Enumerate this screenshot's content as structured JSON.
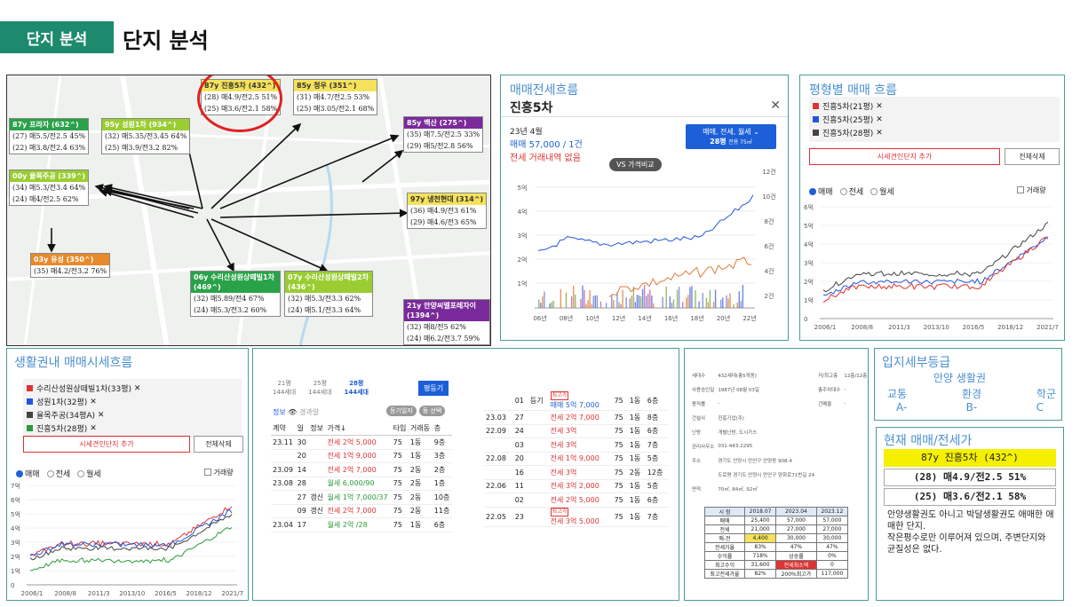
{
  "header": {
    "tag": "단지 분석",
    "title": "단지 분석"
  },
  "map": {
    "labels": [
      {
        "title": "87y 진흥5차 (432^)",
        "color": "#f5e25a",
        "rows": [
          "(28) 매4.9/전2.5 51%",
          "(25) 매3.6/전2.1 58%"
        ]
      },
      {
        "title": "85y 청우 (351^)",
        "color": "#f5e25a",
        "rows": [
          "(31) 매4.7/전2.5 53%",
          "(25) 매3.05/전2.1 68%"
        ]
      },
      {
        "title": "87y 프라자 (632^)",
        "color": "#2aa24a",
        "rows": [
          "(27) 매5.5/전2.5 45%",
          "(22) 매3.8/전2.4 63%"
        ]
      },
      {
        "title": "95y 성원1차 (934^)",
        "color": "#9acd32",
        "rows": [
          "(32) 매5.35/전3.45 64%",
          "(25) 매3.9/전3.2 82%"
        ]
      },
      {
        "title": "85y 백산 (275^)",
        "color": "#7a2a9a",
        "rows": [
          "(35) 매7.5/전2.5 33%",
          "(29) 매5/전2.8 56%"
        ]
      },
      {
        "title": "00y 율목주공 (339^)",
        "color": "#9acd32",
        "rows": [
          "(34) 매5.3/전3.4 64%",
          "(24) 매4/전2.5 62%"
        ]
      },
      {
        "title": "97y 냉천현대 (314^)",
        "color": "#f5e25a",
        "rows": [
          "(36) 매4.9/전3 61%",
          "(29) 매4.6/전3 65%"
        ]
      },
      {
        "title": "03y 유성 (350^)",
        "color": "#e88a2a",
        "rows": [
          "(35) 매4.2/전3.2 76%"
        ]
      },
      {
        "title": "06y 수리산성원상떼빌1차 (469^)",
        "color": "#2aa24a",
        "rows": [
          "(32) 매5.89/전4 67%",
          "(24) 매5.3/전3.2 60%"
        ]
      },
      {
        "title": "07y 수리산성원상떼빌2차 (436^)",
        "color": "#9acd32",
        "rows": [
          "(32) 매5.3/전3.3 62%",
          "(24) 매5.1/전3.3 64%"
        ]
      },
      {
        "title": "21y 안양씨엘포레자이 (1394^)",
        "color": "#7a2a9a",
        "rows": [
          "(32) 매8/전5 62%",
          "(24) 매6.2/전3.7 59%"
        ]
      }
    ]
  },
  "flow": {
    "title": "매매전세흐름",
    "complex": "진흥5차",
    "month": "23년 4월",
    "sale": "매매 57,000 / 1건",
    "rent": "전세 거래내역 없음",
    "filter": "매매, 전세, 월세",
    "size": "28평",
    "size_sub": "전용 75㎡",
    "vs": "VS 가격비교",
    "y_left": [
      "5억",
      "4억",
      "3억",
      "2억",
      "1억"
    ],
    "y_right": [
      "12건",
      "10건",
      "8건",
      "6건",
      "4건",
      "2건"
    ],
    "x": [
      "06년",
      "08년",
      "10년",
      "12년",
      "14년",
      "16년",
      "18년",
      "20년",
      "22년"
    ]
  },
  "pyeong": {
    "title": "평형별 매매 흐름",
    "items": [
      {
        "name": "진흥5차(21평)",
        "color": "#d33"
      },
      {
        "name": "진흥5차(25평)",
        "color": "#2255dd"
      },
      {
        "name": "진흥5차(28평)",
        "color": "#444"
      }
    ],
    "add": "시세견인단지 추가",
    "clear": "전체삭제",
    "radios": [
      "매매",
      "전세",
      "월세"
    ],
    "volume": "거래량",
    "y": [
      "6억",
      "5억",
      "4억",
      "3억",
      "2억",
      "1억",
      "0"
    ],
    "x": [
      "2006/1",
      "2008/8",
      "2011/3",
      "2013/10",
      "2016/5",
      "2018/12",
      "2021/7"
    ]
  },
  "area": {
    "title": "생활권내 매매시세흐름",
    "items": [
      {
        "name": "수리산성원상떼빌1차(33평)",
        "color": "#d33"
      },
      {
        "name": "성원1차(32평)",
        "color": "#2255dd"
      },
      {
        "name": "율목주공(34평A)",
        "color": "#444"
      },
      {
        "name": "진흥5차(28평)",
        "color": "#2a9a3a"
      }
    ],
    "add": "시세견인단지 추가",
    "clear": "전체삭제",
    "radios": [
      "매매",
      "전세",
      "월세"
    ],
    "volume": "거래량",
    "y": [
      "7억",
      "6억",
      "5억",
      "4억",
      "3억",
      "2억",
      "1억",
      "0"
    ],
    "x": [
      "2006/1",
      "2008/8",
      "2011/3",
      "2013/10",
      "2016/5",
      "2018/12",
      "2021/7"
    ]
  },
  "trades": {
    "tabs": [
      {
        "p": "21평",
        "s": "144세대"
      },
      {
        "p": "25평",
        "s": "144세대"
      },
      {
        "p": "28평",
        "s": "144세대"
      }
    ],
    "button": "평등기",
    "info": "정보",
    "auction": "경과알",
    "chip1": "등기일자",
    "chip2": "동 선택",
    "head": [
      "계약",
      "일",
      "정보",
      "가격↓",
      "타입",
      "거래동",
      "층"
    ],
    "rows": [
      {
        "ym": "23.11",
        "d": "30",
        "info": "",
        "price": "전세 2억 5,000",
        "c": "red",
        "t": "75",
        "dong": "1동",
        "fl": "9층"
      },
      {
        "ym": "",
        "d": "20",
        "info": "",
        "price": "전세 1억 9,000",
        "c": "red",
        "t": "75",
        "dong": "1동",
        "fl": "3층"
      },
      {
        "ym": "23.09",
        "d": "14",
        "info": "",
        "price": "전세 2억 7,000",
        "c": "red",
        "t": "75",
        "dong": "2동",
        "fl": "2층"
      },
      {
        "ym": "23.08",
        "d": "28",
        "info": "",
        "price": "월세 6,000/90",
        "c": "green",
        "t": "75",
        "dong": "2동",
        "fl": "1층"
      },
      {
        "ym": "",
        "d": "27",
        "info": "갱신",
        "price": "월세 1억 7,000/37",
        "c": "green",
        "t": "75",
        "dong": "2동",
        "fl": "10층"
      },
      {
        "ym": "",
        "d": "09",
        "info": "갱신",
        "price": "전세 2억 7,000",
        "c": "red",
        "t": "75",
        "dong": "2동",
        "fl": "11층"
      },
      {
        "ym": "23.04",
        "d": "17",
        "info": "",
        "price": "월세 2억 /28",
        "c": "green",
        "t": "75",
        "dong": "1동",
        "fl": "6층"
      }
    ],
    "rows2": [
      {
        "ym": "",
        "d": "01",
        "info": "등기",
        "price": "매매 5억 7,000",
        "c": "blue",
        "t": "75",
        "dong": "1동",
        "fl": "6층",
        "tag": "최고가"
      },
      {
        "ym": "23.03",
        "d": "27",
        "info": "",
        "price": "전세 2억 7,000",
        "c": "red",
        "t": "75",
        "dong": "1동",
        "fl": "8층"
      },
      {
        "ym": "22.09",
        "d": "24",
        "info": "",
        "price": "전세 3억",
        "c": "red",
        "t": "75",
        "dong": "1동",
        "fl": "6층"
      },
      {
        "ym": "",
        "d": "03",
        "info": "",
        "price": "전세 3억",
        "c": "red",
        "t": "75",
        "dong": "1동",
        "fl": "7층"
      },
      {
        "ym": "22.08",
        "d": "20",
        "info": "",
        "price": "전세 1억 9,000",
        "c": "red",
        "t": "75",
        "dong": "1동",
        "fl": "5층"
      },
      {
        "ym": "",
        "d": "16",
        "info": "",
        "price": "전세 3억",
        "c": "red",
        "t": "75",
        "dong": "2동",
        "fl": "12층"
      },
      {
        "ym": "22.06",
        "d": "11",
        "info": "",
        "price": "전세 3억 2,000",
        "c": "red",
        "t": "75",
        "dong": "1동",
        "fl": "5층"
      },
      {
        "ym": "",
        "d": "02",
        "info": "",
        "price": "전세 2억 5,000",
        "c": "red",
        "t": "75",
        "dong": "1동",
        "fl": "6층"
      },
      {
        "ym": "22.05",
        "d": "23",
        "info": "",
        "price": "전세 3억 5,000",
        "c": "red",
        "t": "75",
        "dong": "1동",
        "fl": "7층",
        "tag": "최고가"
      }
    ]
  },
  "detail": {
    "rows": [
      [
        "세대수",
        "432세대(총5개동)",
        "저/최고층",
        "12층/12층"
      ],
      [
        "사용승인일",
        "1987년 08월 03일",
        "총주차대수",
        "-"
      ],
      [
        "용적률",
        "-",
        "건폐율",
        "-"
      ],
      [
        "건설사",
        "진흥기업(주)",
        "",
        ""
      ],
      [
        "난방",
        "개별난방, 도시가스",
        "",
        ""
      ],
      [
        "관리사무소",
        "031-443-2295",
        "",
        ""
      ],
      [
        "주소",
        "경기도 안양시 만안구 안양동 908-4",
        "",
        ""
      ],
      [
        "",
        "도로명 경기도 안양시 만안구 양화로71번길 24",
        "",
        ""
      ],
      [
        "면적",
        "70㎡, 84㎡, 92㎡",
        "",
        ""
      ]
    ],
    "yt_head": [
      "시 점",
      "2018.07",
      "2023.04",
      "2023.12"
    ],
    "yt_rows": [
      [
        "매매",
        "25,400",
        "57,000",
        "57,000"
      ],
      [
        "전세",
        "21,000",
        "27,000",
        "27,000"
      ],
      [
        "매-전",
        "4,400",
        "30,000",
        "30,000"
      ],
      [
        "전세가율",
        "83%",
        "47%",
        "47%"
      ],
      [
        "수익률",
        "718%",
        "상승률",
        "0%"
      ],
      [
        "최고수익",
        "31,600",
        "전세최소액",
        "0"
      ],
      [
        "최고전세가율",
        "82%",
        "200%최고가",
        "117,000"
      ]
    ]
  },
  "location": {
    "title": "입지세부등급",
    "area": "안양 생활권",
    "cats": [
      "교통",
      "환경",
      "학군"
    ],
    "grades": [
      "A-",
      "B-",
      "C"
    ]
  },
  "current": {
    "title": "현재 매매/전세가",
    "name": "87y 진흥5차 (432^)",
    "rows": [
      "(28) 매4.9/전2.5 51%",
      "(25) 매3.6/전2.1 58%"
    ],
    "note1": "안양생활권도 아니고 박달생활권도 애매한 애매한 단지.",
    "note2": "작은평수로만 이루어져 있으며, 주변단지와 균질성은 없다."
  }
}
